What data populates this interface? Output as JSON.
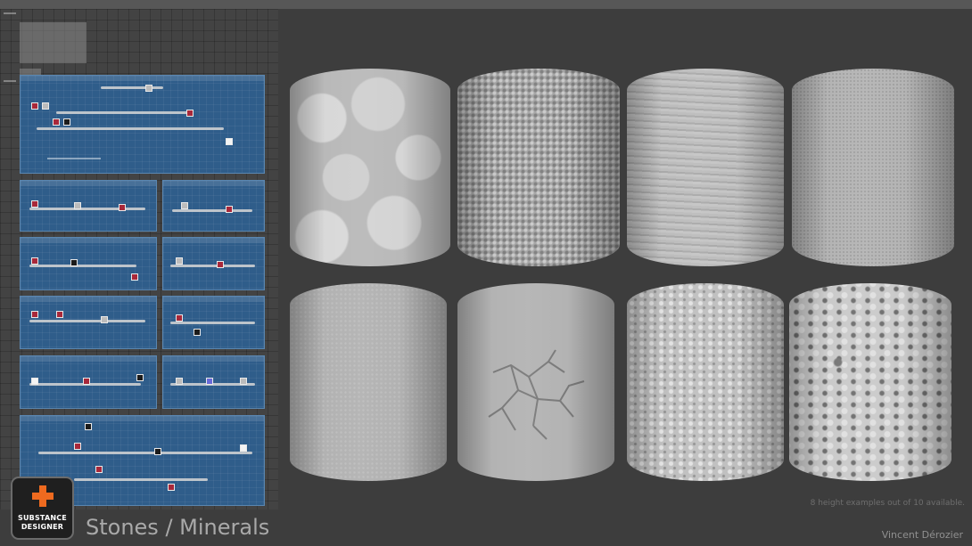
{
  "title": "Stones / Minerals",
  "caption": "8 height examples out of 10 available.",
  "author": "Vincent Dérozier",
  "logo": {
    "line1": "SUBSTANCE",
    "line2": "DESIGNER",
    "accent": "#ee6a1f",
    "icon": "plus-icon"
  },
  "samples": [
    {
      "kind": "pebbles"
    },
    {
      "kind": "porous"
    },
    {
      "kind": "layered"
    },
    {
      "kind": "fine-grain"
    },
    {
      "kind": "rough-plaster"
    },
    {
      "kind": "cracked"
    },
    {
      "kind": "speckled"
    },
    {
      "kind": "eroded"
    }
  ],
  "colors": {
    "background": "#3d3d3d",
    "frame": "#2f5d8a",
    "node_red": "#a8283a"
  }
}
